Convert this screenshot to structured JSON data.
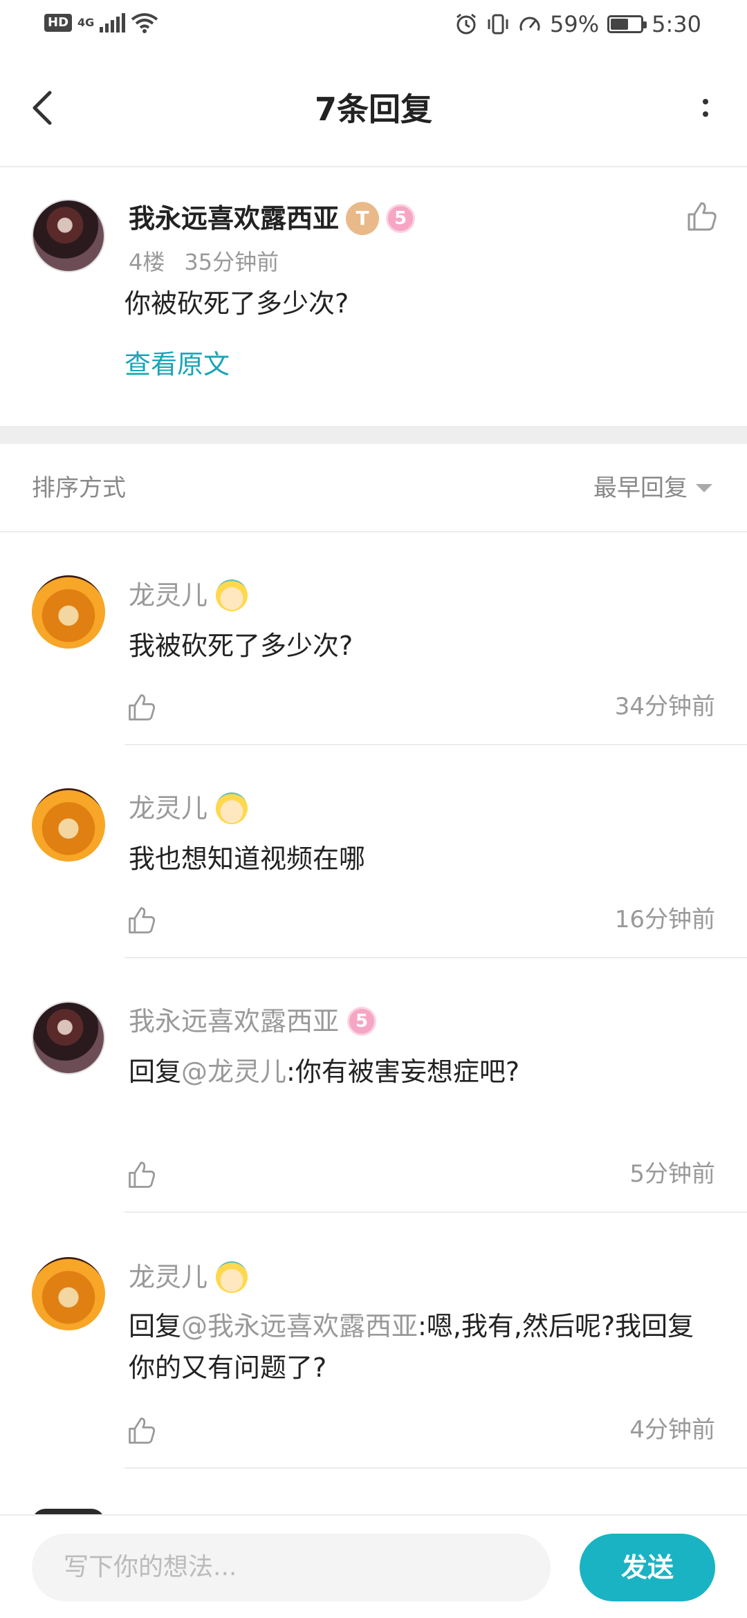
{
  "status_bar": {
    "hd": "HD",
    "network": "4G",
    "battery": "59%",
    "battery_level": 0.59,
    "time": "5:30"
  },
  "header": {
    "title": "7条回复"
  },
  "post": {
    "author": "我永远喜欢露西亚",
    "badge_t": "T",
    "badge_level": "5",
    "floor": "4楼",
    "time": "35分钟前",
    "text": "你被砍死了多少次?",
    "view_original": "查看原文"
  },
  "sort": {
    "label": "排序方式",
    "selected": "最早回复"
  },
  "replies": [
    {
      "author": "龙灵儿",
      "prefix": "",
      "mention": "",
      "text": "我被砍死了多少次?",
      "time": "34分钟前"
    },
    {
      "author": "龙灵儿",
      "prefix": "",
      "mention": "",
      "text": "我也想知道视频在哪",
      "time": "16分钟前"
    },
    {
      "author": "我永远喜欢露西亚",
      "badge_level": "5",
      "prefix": "回复",
      "mention": "@龙灵儿",
      "text": ":你有被害妄想症吧?",
      "time": "5分钟前"
    },
    {
      "author": "龙灵儿",
      "prefix": "回复",
      "mention": "@我永远喜欢露西亚",
      "text": ":嗯,我有,然后呢?我回复你的又有问题了?",
      "time": "4分钟前"
    }
  ],
  "composer": {
    "placeholder": "写下你的想法...",
    "send_label": "发送"
  },
  "colors": {
    "accent": "#1ab3c4",
    "link": "#1aa5b5",
    "muted_text": "#999999"
  }
}
